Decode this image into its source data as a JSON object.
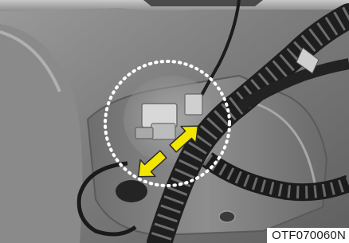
{
  "figure": {
    "code": "OTF070060N"
  },
  "colors": {
    "arrow_fill": "#f2e600",
    "arrow_outline": "#2a2a2a",
    "highlight_circle": "#ffffff"
  }
}
